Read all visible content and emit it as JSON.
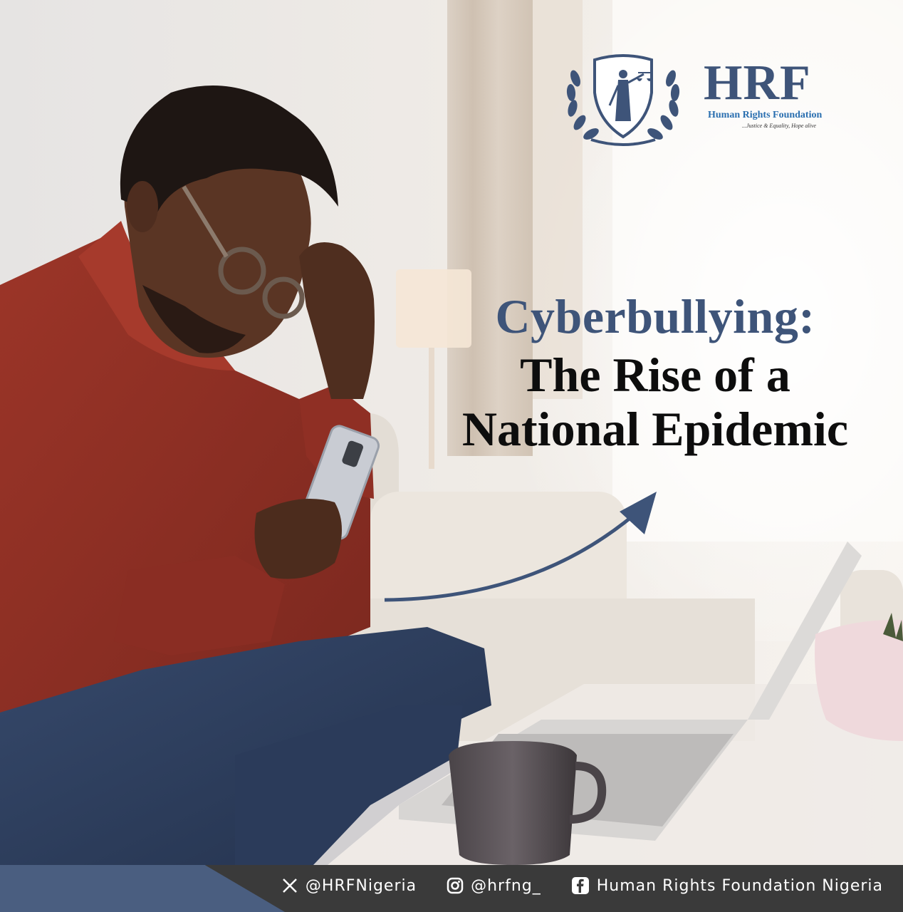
{
  "headline": {
    "line1": "Cyberbullying:",
    "line2": "The Rise of a",
    "line3": "National Epidemic"
  },
  "logo": {
    "brand": "HRF",
    "organization": "Human Rights Foundation",
    "tagline": "...Justice & Equality, Hope alive"
  },
  "footer": {
    "twitter_handle": "@HRFNigeria",
    "instagram_handle": "@hrfng_",
    "facebook_name": "Human Rights Foundation Nigeria"
  },
  "icons": {
    "twitter": "x-icon",
    "instagram": "instagram-icon",
    "facebook": "facebook-icon"
  },
  "colors": {
    "accent": "#3e5479",
    "headline_dark": "#0d0d0d",
    "footer_bar": "#3a3a3a",
    "footer_accent": "#4a5e80",
    "sweater": "#8e2f25",
    "jeans": "#2e3d5c"
  }
}
